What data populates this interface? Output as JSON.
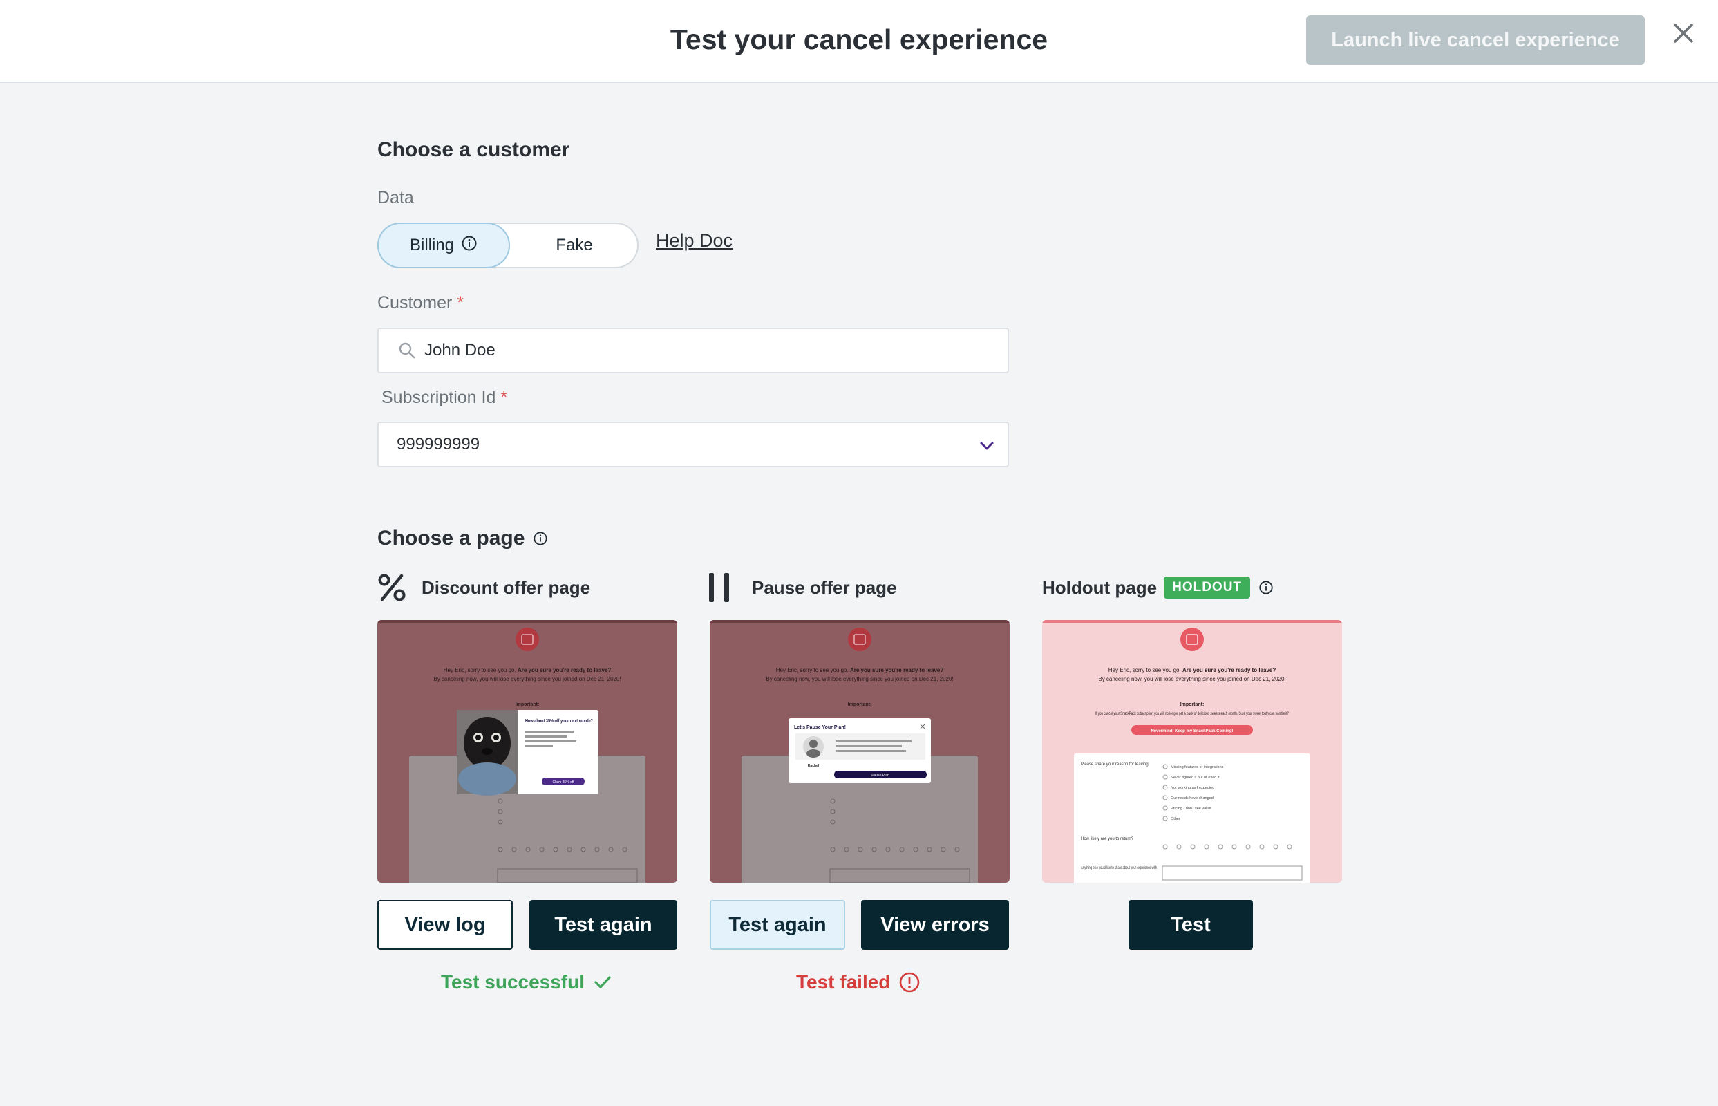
{
  "header": {
    "title": "Test your cancel experience",
    "launch_label": "Launch live cancel experience"
  },
  "customer_section": {
    "title": "Choose a customer",
    "data_label": "Data",
    "toggle": {
      "billing_label": "Billing",
      "fake_label": "Fake",
      "selected": "Billing"
    },
    "help_link": "Help Doc",
    "customer_label": "Customer",
    "required_mark": "*",
    "customer_value": "John Doe",
    "subscription_label": "Subscription Id",
    "subscription_value": "999999999"
  },
  "page_section": {
    "title": "Choose a page",
    "cards": [
      {
        "title": "Discount offer page",
        "icon": "percent-icon",
        "preview": {
          "greeting": "Hey Eric, sorry to see you go.",
          "greeting_bold": "Are you sure you're ready to leave?",
          "subline": "By canceling now, you will lose everything since you joined on Dec 21, 2020!",
          "important": "Important:",
          "popup_title": "How about 35% off your next month?",
          "popup_button": "Claim 35% off"
        },
        "buttons": [
          "View log",
          "Test again"
        ],
        "status": "Test successful",
        "status_type": "success"
      },
      {
        "title": "Pause offer page",
        "icon": "pause-icon",
        "preview": {
          "greeting": "Hey Eric, sorry to see you go.",
          "greeting_bold": "Are you sure you're ready to leave?",
          "subline": "By canceling now, you will lose everything since you joined on Dec 21, 2020!",
          "important": "Important:",
          "popup_title": "Let's Pause Your Plan!",
          "popup_name": "Rachel",
          "popup_button": "Pause Plan"
        },
        "buttons": [
          "Test again",
          "View errors"
        ],
        "status": "Test failed",
        "status_type": "error"
      },
      {
        "title": "Holdout page",
        "badge": "HOLDOUT",
        "preview": {
          "greeting": "Hey Eric, sorry to see you go.",
          "greeting_bold": "Are you sure you're ready to leave?",
          "subline": "By canceling now, you will lose everything since you joined on Dec 21, 2020!",
          "important": "Important:",
          "body": "If you cancel your SnackPack subscription you will no longer get a pack of delicious sweets each month. Sure your sweet tooth can handle it?",
          "pill": "Nevermind! Keep my SnackPack Coming!",
          "reason_label": "Please share your reason for leaving",
          "options": [
            "Missing features or integrations",
            "Never figured it out or used it",
            "Not working as I expected",
            "Our needs have changed",
            "Pricing - don't see value",
            "Other"
          ],
          "return_label": "How likely are you to return?",
          "share_label": "Anything else you'd like to share about your experience with"
        },
        "buttons": [
          "Test"
        ]
      }
    ]
  },
  "colors": {
    "success": "#3fa55a",
    "error": "#d63d3d",
    "dark_button": "#07262f",
    "holdout_badge": "#3fae5a",
    "preview_bg_dim": "#8e5d61",
    "preview_bg_pink": "#f7d2d5"
  }
}
